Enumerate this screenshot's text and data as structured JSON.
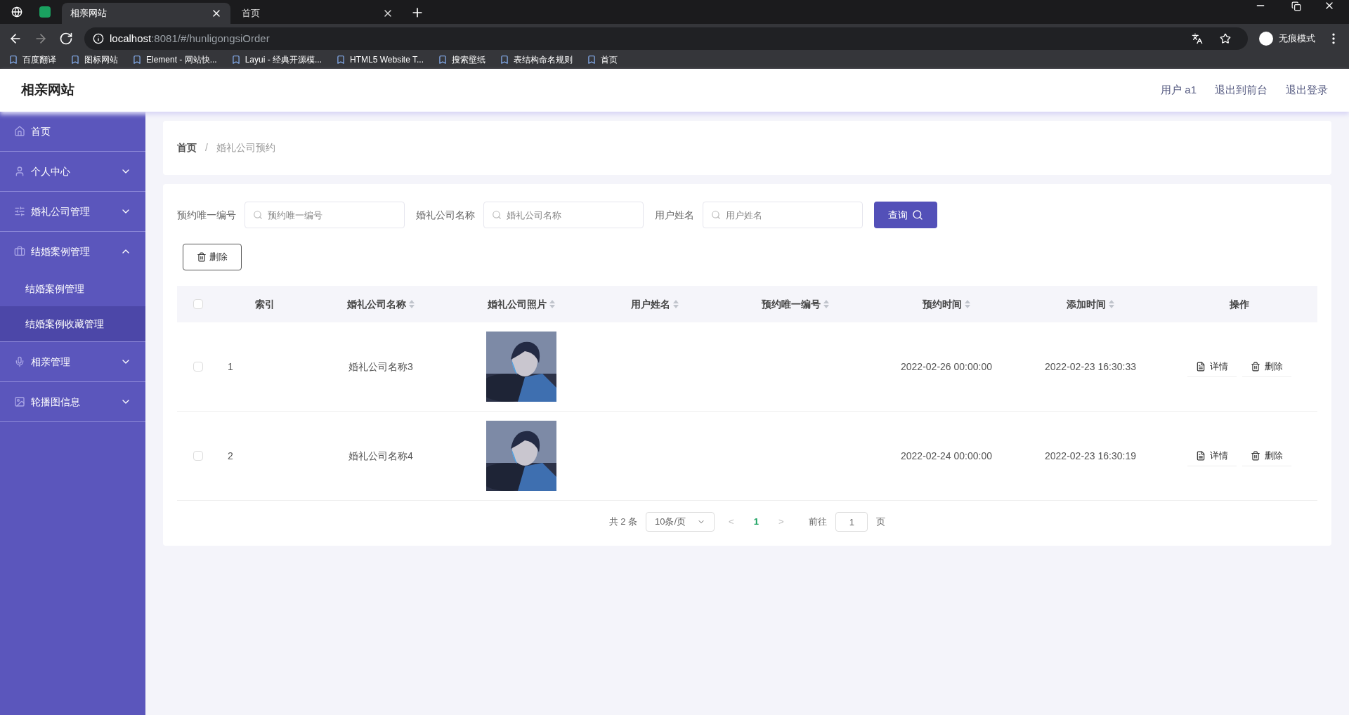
{
  "browser": {
    "tabs": [
      {
        "title": "相亲网站",
        "selected": true
      },
      {
        "title": "首页",
        "selected": false
      }
    ],
    "url_host": "localhost",
    "url_path": ":8081/#/hunligongsiOrder",
    "profile": "无痕模式",
    "bookmarks": [
      "百度翻译",
      "图标网站",
      "Element - 网站快...",
      "Layui - 经典开源模...",
      "HTML5 Website T...",
      "搜索壁纸",
      "表结构命名规则",
      "首页"
    ]
  },
  "header": {
    "title": "相亲网站",
    "links": [
      "用户 a1",
      "退出到前台",
      "退出登录"
    ]
  },
  "sidebar": {
    "items": [
      {
        "label": "首页"
      },
      {
        "label": "个人中心",
        "expanded": false
      },
      {
        "label": "婚礼公司管理",
        "expanded": false
      },
      {
        "label": "结婚案例管理",
        "expanded": true,
        "children": [
          {
            "label": "结婚案例管理",
            "selected": false
          },
          {
            "label": "结婚案例收藏管理",
            "selected": true
          }
        ]
      },
      {
        "label": "相亲管理",
        "expanded": false
      },
      {
        "label": "轮播图信息",
        "expanded": false
      }
    ]
  },
  "breadcrumb": {
    "items": [
      "首页",
      "婚礼公司预约"
    ],
    "separator": "/"
  },
  "filters": [
    {
      "label": "预约唯一编号",
      "placeholder": "预约唯一编号"
    },
    {
      "label": "婚礼公司名称",
      "placeholder": "婚礼公司名称"
    },
    {
      "label": "用户姓名",
      "placeholder": "用户姓名"
    }
  ],
  "search_button": "查询",
  "delete_button": "删除",
  "table": {
    "all_checked": false,
    "columns": [
      "索引",
      "婚礼公司名称",
      "婚礼公司照片",
      "用户姓名",
      "预约唯一编号",
      "预约时间",
      "添加时间",
      "操作"
    ],
    "rows": [
      {
        "checked": false,
        "index": "1",
        "company": "婚礼公司名称3",
        "photo": {
          "kind": "picture"
        },
        "booked": "2022-02-26 00:00:00",
        "added": "2022-02-23 16:30:33",
        "actions": [
          "详情",
          "删除"
        ]
      },
      {
        "checked": false,
        "index": "2",
        "company": "婚礼公司名称4",
        "photo": {
          "kind": "picture"
        },
        "booked": "2022-02-24 00:00:00",
        "added": "2022-02-23 16:30:19",
        "actions": [
          "详情",
          "删除"
        ]
      }
    ]
  },
  "pagination": {
    "total": "共 2 条",
    "page_size": "10条/页",
    "prev": "<",
    "pages": [
      {
        "label": "1",
        "selected": true
      }
    ],
    "next": ">",
    "goto_label": "前往",
    "goto_value": "1",
    "goto_suffix": "页"
  }
}
